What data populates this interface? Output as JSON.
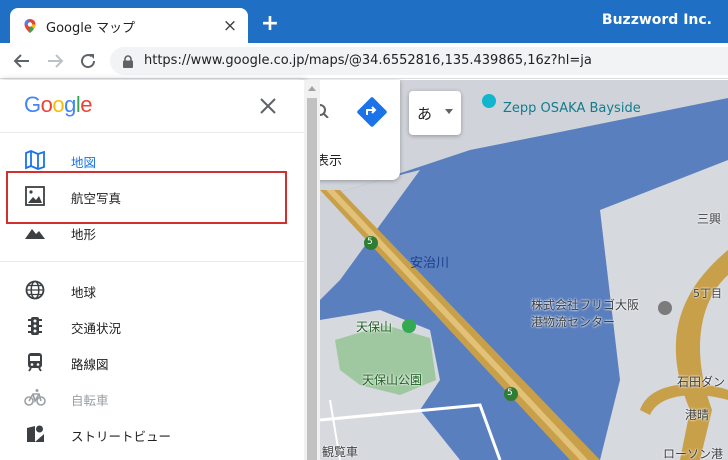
{
  "browser": {
    "tab_title": "Google マップ",
    "tab_close": "×",
    "new_tab": "+",
    "brand": "Buzzword Inc.",
    "url": "https://www.google.co.jp/maps/@34.6552816,135.439865,16z?hl=ja"
  },
  "menu": {
    "logo_letters": [
      "G",
      "o",
      "o",
      "g",
      "l",
      "e"
    ],
    "logo_colors": [
      "#4285f4",
      "#ea4335",
      "#fbbc05",
      "#4285f4",
      "#34a853",
      "#ea4335"
    ],
    "items": [
      {
        "label": "地図",
        "icon": "map-icon",
        "state": "active"
      },
      {
        "label": "航空写真",
        "icon": "satellite-image-icon",
        "state": "normal"
      },
      {
        "label": "地形",
        "icon": "terrain-icon",
        "state": "normal"
      },
      {
        "label": "地球",
        "icon": "globe-icon",
        "state": "normal"
      },
      {
        "label": "交通状況",
        "icon": "traffic-icon",
        "state": "normal"
      },
      {
        "label": "路線図",
        "icon": "transit-icon",
        "state": "normal"
      },
      {
        "label": "自転車",
        "icon": "bicycle-icon",
        "state": "disabled"
      },
      {
        "label": "ストリートビュー",
        "icon": "street-view-icon",
        "state": "normal"
      }
    ]
  },
  "map_controls": {
    "show_label": "表示",
    "language_label": "あ"
  },
  "map": {
    "labels": {
      "zepp": "Zepp OSAKA Bayside",
      "river": "安治川",
      "company_line1": "株式会社フリゴ大阪",
      "company_line2": "港物流センター",
      "tenpozan": "天保山",
      "tenpozan_park": "天保山公園",
      "route_5_a": "5",
      "route_5_b": "5",
      "mitsuru": "三興",
      "chome": "5丁目",
      "ishida": "石田ダン",
      "minato": "港晴",
      "lawson": "ローソン港",
      "ferris": "観覧車"
    },
    "colors": {
      "water": "#5a7fbf",
      "land": "#d6d9de",
      "highway": "#c9a04a",
      "park": "#9fc7a0"
    }
  }
}
